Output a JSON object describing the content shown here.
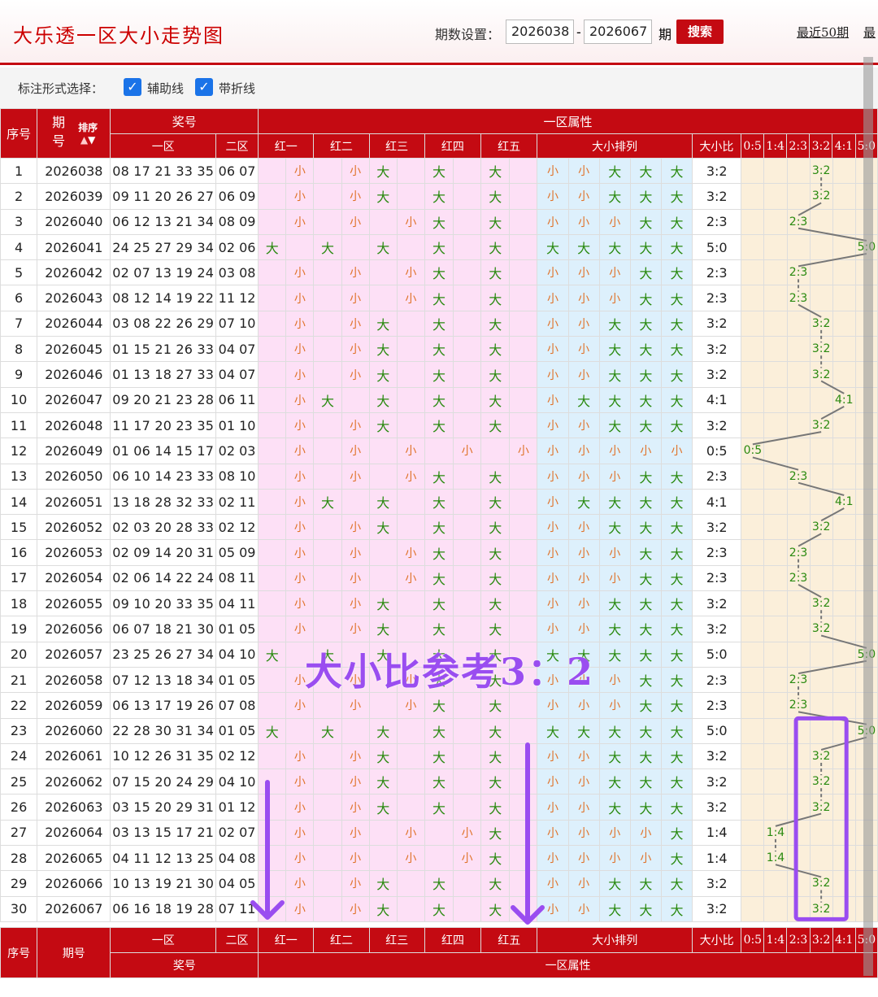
{
  "header": {
    "title": "大乐透一区大小走势图",
    "period_label": "期数设置：",
    "from": "2026038",
    "to": "2026067",
    "qi": "期",
    "search": "搜索",
    "recent": "最近50期",
    "more": "最"
  },
  "options": {
    "label": "标注形式选择：",
    "aux": "辅助线",
    "fold": "带折线"
  },
  "table": {
    "h_seq": "序号",
    "h_qi": "期号",
    "h_sort": "排序",
    "h_award": "奖号",
    "h_attr": "一区属性",
    "h_zone1": "一区",
    "h_zone2": "二区",
    "h_reds": [
      "红一",
      "红二",
      "红三",
      "红四",
      "红五"
    ],
    "h_arr": "大小排列",
    "h_ratio": "大小比",
    "ratios": [
      "0:5",
      "1:4",
      "2:3",
      "3:2",
      "4:1",
      "5:0"
    ],
    "rows": [
      [
        "1",
        "2026038",
        "08 17 21 33 35",
        "06 07",
        "3:2"
      ],
      [
        "2",
        "2026039",
        "09 11 20 26 27",
        "06 09",
        "3:2"
      ],
      [
        "3",
        "2026040",
        "06 12 13 21 34",
        "08 09",
        "2:3"
      ],
      [
        "4",
        "2026041",
        "24 25 27 29 34",
        "02 06",
        "5:0"
      ],
      [
        "5",
        "2026042",
        "02 07 13 19 24",
        "03 08",
        "2:3"
      ],
      [
        "6",
        "2026043",
        "08 12 14 19 22",
        "11 12",
        "2:3"
      ],
      [
        "7",
        "2026044",
        "03 08 22 26 29",
        "07 10",
        "3:2"
      ],
      [
        "8",
        "2026045",
        "01 15 21 26 33",
        "04 07",
        "3:2"
      ],
      [
        "9",
        "2026046",
        "01 13 18 27 33",
        "04 07",
        "3:2"
      ],
      [
        "10",
        "2026047",
        "09 20 21 23 28",
        "06 11",
        "4:1"
      ],
      [
        "11",
        "2026048",
        "11 17 20 23 35",
        "01 10",
        "3:2"
      ],
      [
        "12",
        "2026049",
        "01 06 14 15 17",
        "02 03",
        "0:5"
      ],
      [
        "13",
        "2026050",
        "06 10 14 23 33",
        "08 10",
        "2:3"
      ],
      [
        "14",
        "2026051",
        "13 18 28 32 33",
        "02 11",
        "4:1"
      ],
      [
        "15",
        "2026052",
        "02 03 20 28 33",
        "02 12",
        "3:2"
      ],
      [
        "16",
        "2026053",
        "02 09 14 20 31",
        "05 09",
        "2:3"
      ],
      [
        "17",
        "2026054",
        "02 06 14 22 24",
        "08 11",
        "2:3"
      ],
      [
        "18",
        "2026055",
        "09 10 20 33 35",
        "04 11",
        "3:2"
      ],
      [
        "19",
        "2026056",
        "06 07 18 21 30",
        "01 05",
        "3:2"
      ],
      [
        "20",
        "2026057",
        "23 25 26 27 34",
        "04 10",
        "5:0"
      ],
      [
        "21",
        "2026058",
        "07 12 13 18 34",
        "01 05",
        "2:3"
      ],
      [
        "22",
        "2026059",
        "06 13 17 19 26",
        "07 08",
        "2:3"
      ],
      [
        "23",
        "2026060",
        "22 28 30 31 34",
        "01 05",
        "5:0"
      ],
      [
        "24",
        "2026061",
        "10 12 26 31 35",
        "02 12",
        "3:2"
      ],
      [
        "25",
        "2026062",
        "07 15 20 24 29",
        "04 10",
        "3:2"
      ],
      [
        "26",
        "2026063",
        "03 15 20 29 31",
        "01 12",
        "3:2"
      ],
      [
        "27",
        "2026064",
        "03 13 15 17 21",
        "02 07",
        "1:4"
      ],
      [
        "28",
        "2026065",
        "04 11 12 13 25",
        "04 08",
        "1:4"
      ],
      [
        "29",
        "2026066",
        "10 13 19 21 30",
        "04 05",
        "3:2"
      ],
      [
        "30",
        "2026067",
        "06 16 18 19 28",
        "07 11",
        "3:2"
      ]
    ],
    "big": "大",
    "small": "小"
  },
  "annotation": "大小比参考3：2",
  "colors": {
    "header_red": "#c40a12",
    "big": "#2a8a10",
    "small": "#e0732a",
    "annotation": "#9a4df0"
  }
}
